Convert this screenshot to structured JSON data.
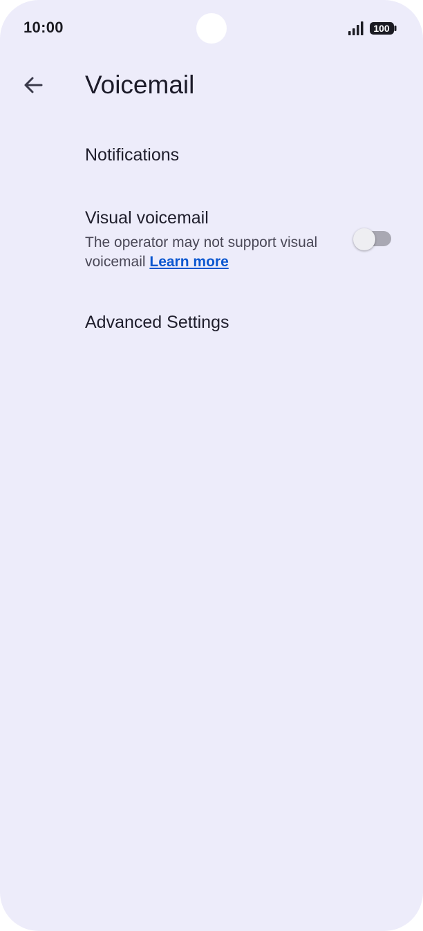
{
  "status_bar": {
    "time": "10:00",
    "battery_level": "100",
    "icons": [
      "signal-icon",
      "battery-icon"
    ]
  },
  "header": {
    "back_icon": "arrow-left-icon",
    "title": "Voicemail"
  },
  "settings": {
    "notifications": {
      "title": "Notifications"
    },
    "visual_voicemail": {
      "title": "Visual voicemail",
      "summary": "The operator may not support visual voicemail",
      "link_text": "Learn more",
      "toggle_on": false
    },
    "advanced": {
      "title": "Advanced Settings"
    }
  },
  "colors": {
    "background": "#edecfa",
    "link": "#0b57d0",
    "toggle_track_off": "#a9a8b3"
  }
}
